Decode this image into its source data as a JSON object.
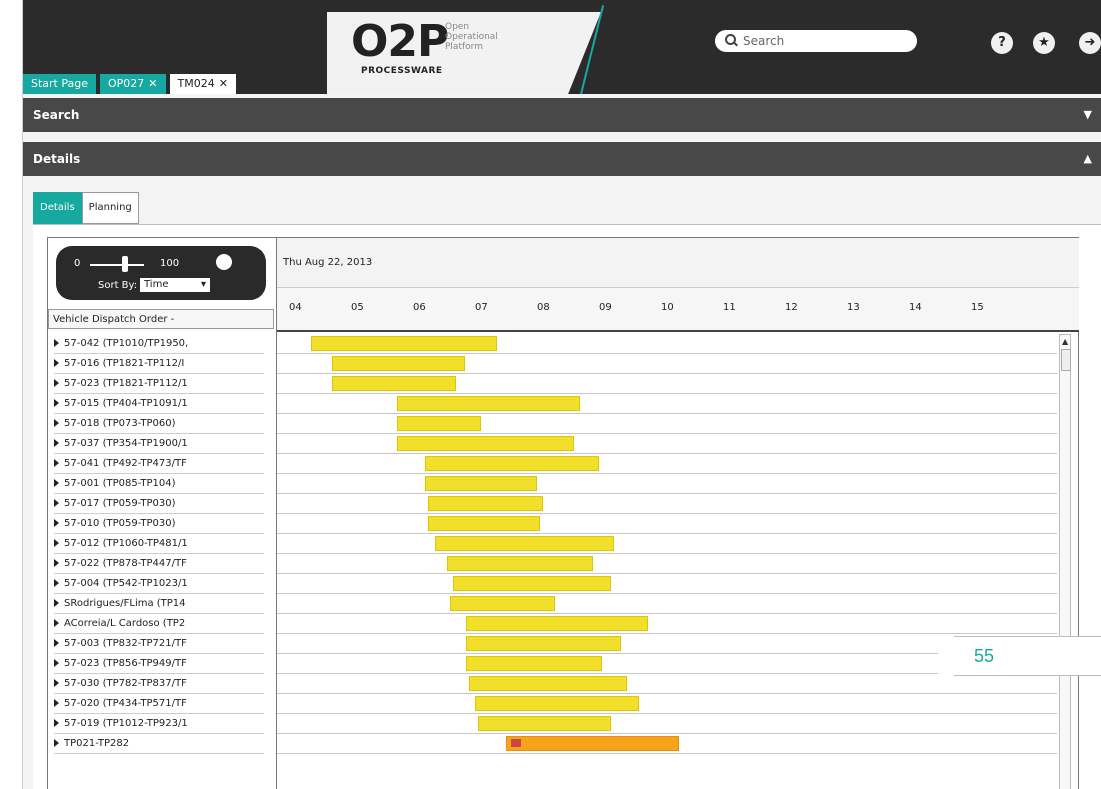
{
  "brand": {
    "logo": "O2P",
    "tagline": "Open Operational Platform",
    "maker": "PROCESSWARE"
  },
  "search": {
    "placeholder": "Search"
  },
  "header_icons": [
    "help-icon",
    "star-icon",
    "logout-icon"
  ],
  "tabs": [
    {
      "label": "Start Page",
      "closable": false,
      "active": false
    },
    {
      "label": "OP027",
      "closable": true,
      "active": false
    },
    {
      "label": "TM024",
      "closable": true,
      "active": true
    }
  ],
  "panels": {
    "search": "Search",
    "details": "Details"
  },
  "inner_tabs": [
    "Details",
    "Planning"
  ],
  "controls": {
    "slider_min": "0",
    "slider_max": "100",
    "slider_value": 0.55,
    "sort_label": "Sort By:",
    "sort_value": "Time"
  },
  "list_header": "Vehicle Dispatch Order -",
  "timeline": {
    "date": "Thu Aug 22, 2013",
    "hours": [
      "04",
      "05",
      "06",
      "07",
      "08",
      "09",
      "10",
      "11",
      "12",
      "13",
      "14",
      "15"
    ]
  },
  "rows": [
    {
      "label": "57-042 (TP1010/TP1950,",
      "start": 4.25,
      "end": 7.25
    },
    {
      "label": "57-016 (TP1821-TP112/I",
      "start": 4.6,
      "end": 6.75
    },
    {
      "label": "57-023 (TP1821-TP112/1",
      "start": 4.6,
      "end": 6.6
    },
    {
      "label": "57-015 (TP404-TP1091/1",
      "start": 5.65,
      "end": 8.6
    },
    {
      "label": "57-018 (TP073-TP060)",
      "start": 5.65,
      "end": 7.0
    },
    {
      "label": "57-037 (TP354-TP1900/1",
      "start": 5.65,
      "end": 8.5
    },
    {
      "label": "57-041 (TP492-TP473/TF",
      "start": 6.1,
      "end": 8.9
    },
    {
      "label": "57-001 (TP085-TP104)",
      "start": 6.1,
      "end": 7.9
    },
    {
      "label": "57-017 (TP059-TP030)",
      "start": 6.15,
      "end": 8.0
    },
    {
      "label": "57-010 (TP059-TP030)",
      "start": 6.15,
      "end": 7.95
    },
    {
      "label": "57-012 (TP1060-TP481/1",
      "start": 6.25,
      "end": 9.15
    },
    {
      "label": "57-022 (TP878-TP447/TF",
      "start": 6.45,
      "end": 8.8
    },
    {
      "label": "57-004 (TP542-TP1023/1",
      "start": 6.55,
      "end": 9.1
    },
    {
      "label": "SRodrigues/FLima (TP14",
      "start": 6.5,
      "end": 8.2
    },
    {
      "label": "ACorreia/L Cardoso (TP2",
      "start": 6.75,
      "end": 9.7
    },
    {
      "label": "57-003 (TP832-TP721/TF",
      "start": 6.75,
      "end": 9.25
    },
    {
      "label": "57-023 (TP856-TP949/TF",
      "start": 6.75,
      "end": 8.95
    },
    {
      "label": "57-030 (TP782-TP837/TF",
      "start": 6.8,
      "end": 9.35
    },
    {
      "label": "57-020 (TP434-TP571/TF",
      "start": 6.9,
      "end": 9.55
    },
    {
      "label": "57-019 (TP1012-TP923/1",
      "start": 6.95,
      "end": 9.1
    },
    {
      "label": "TP021-TP282",
      "start": 7.4,
      "end": 10.2,
      "highlight": true
    }
  ],
  "page_number": "55",
  "colors": {
    "accent": "#17a9a0",
    "bar": "#f2df2a",
    "bar_highlight": "#f8a41a"
  }
}
